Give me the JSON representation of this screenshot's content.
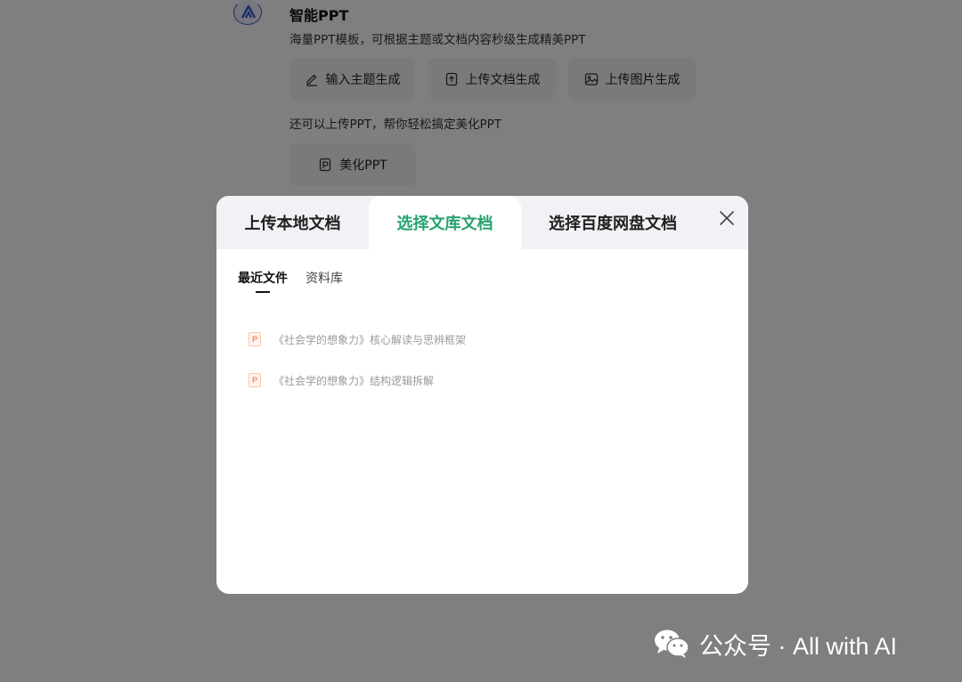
{
  "background": {
    "title": "智能PPT",
    "description": "海量PPT模板，可根据主题或文档内容秒级生成精美PPT",
    "buttons": [
      {
        "label": "输入主题生成",
        "icon": "pencil-icon"
      },
      {
        "label": "上传文档生成",
        "icon": "upload-file-icon"
      },
      {
        "label": "上传图片生成",
        "icon": "image-icon"
      }
    ],
    "description2": "还可以上传PPT，帮你轻松搞定美化PPT",
    "beautify_button": {
      "label": "美化PPT",
      "icon": "ppt-file-icon"
    },
    "avatar_icon": "app-logo-icon"
  },
  "modal": {
    "tabs": [
      {
        "label": "上传本地文档",
        "active": false
      },
      {
        "label": "选择文库文档",
        "active": true
      },
      {
        "label": "选择百度网盘文档",
        "active": false
      }
    ],
    "close_icon": "close-icon",
    "subtabs": [
      {
        "label": "最近文件",
        "active": true
      },
      {
        "label": "资料库",
        "active": false
      }
    ],
    "files": [
      {
        "name": "《社会学的想象力》核心解读与思辨框架",
        "type_badge": "P"
      },
      {
        "name": "《社会学的想象力》结构逻辑拆解",
        "type_badge": "P"
      }
    ]
  },
  "watermark": {
    "text": "公众号 · All with AI",
    "icon": "wechat-icon"
  },
  "colors": {
    "accent": "#25a36d",
    "overlay": "rgba(0,0,0,0.5)",
    "tab_bar": "#f1f2f5",
    "ppt_badge": "#f08a5d"
  }
}
